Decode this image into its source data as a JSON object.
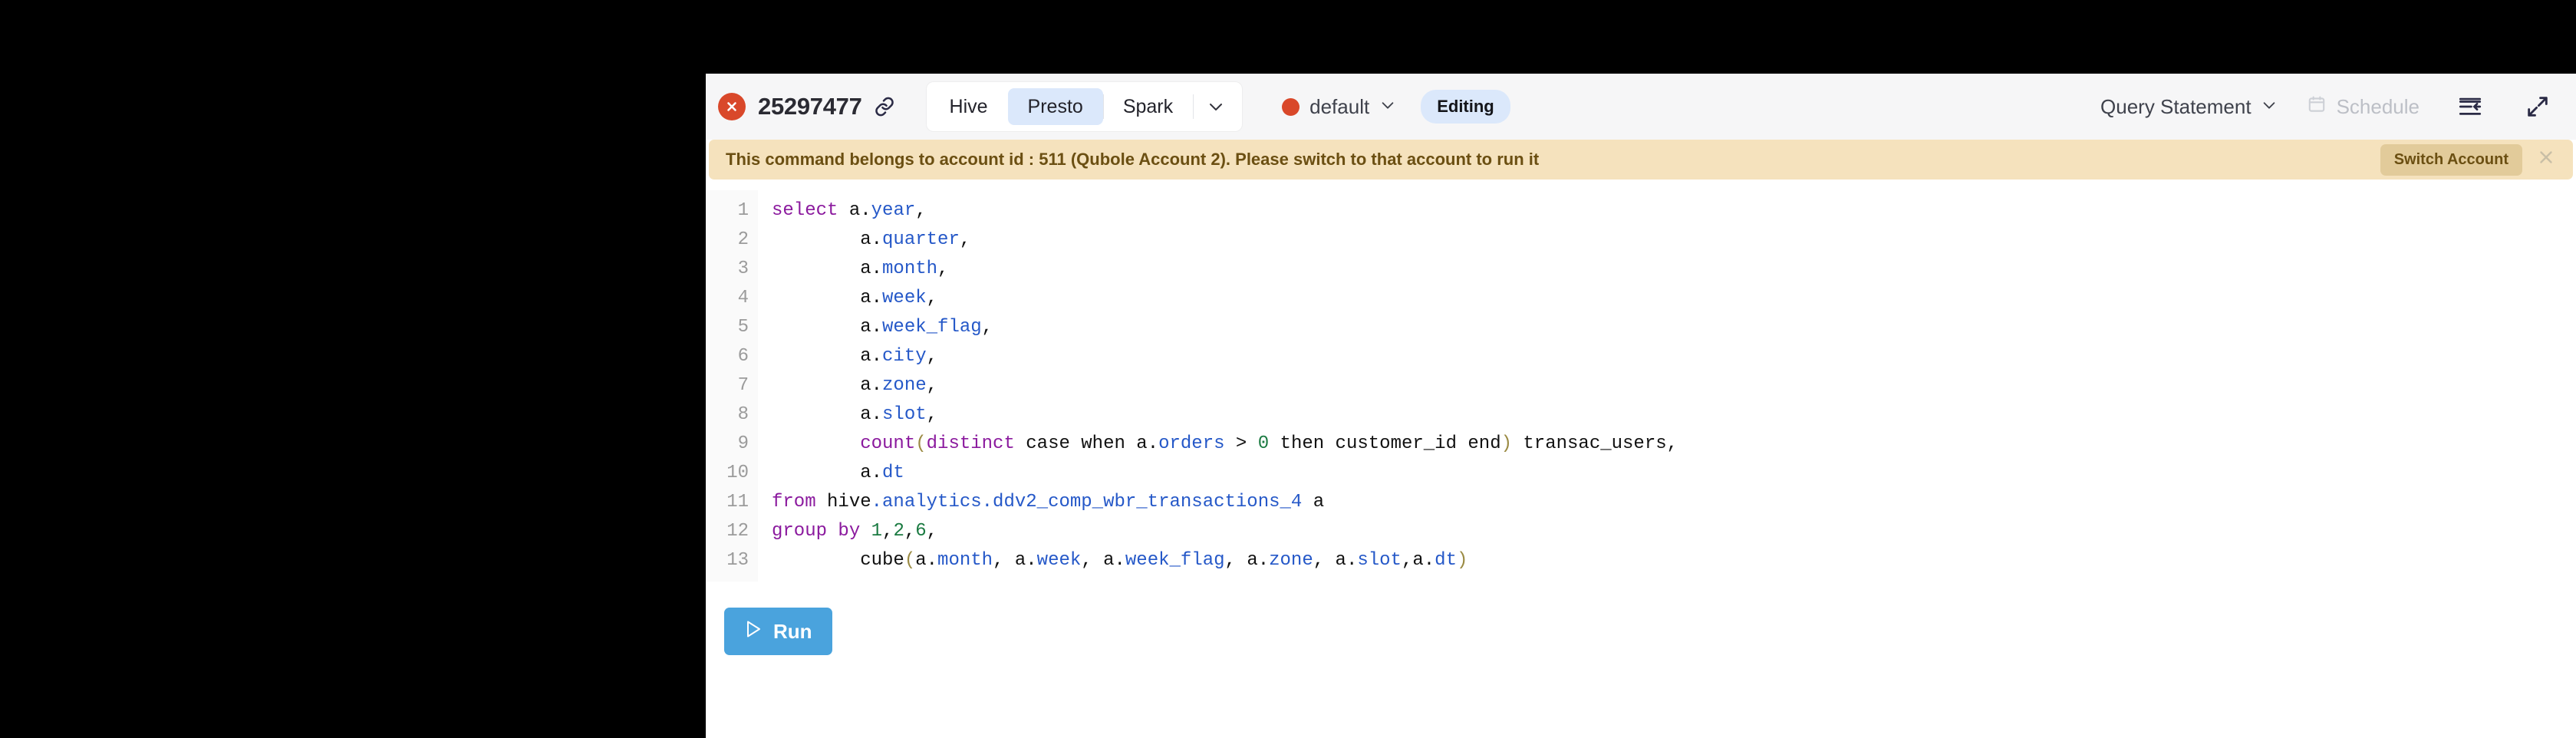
{
  "toolbar": {
    "status_icon": "error-close-icon",
    "query_id": "25297477",
    "link_icon": "link-icon",
    "engines": [
      {
        "label": "Hive",
        "selected": false
      },
      {
        "label": "Presto",
        "selected": true
      },
      {
        "label": "Spark",
        "selected": false
      }
    ],
    "engine_caret_icon": "chevron-down-icon",
    "cluster": {
      "name": "default",
      "status_color": "#d9482a",
      "caret_icon": "chevron-down-icon"
    },
    "editing_badge": "Editing",
    "query_statement": {
      "label": "Query Statement",
      "caret_icon": "chevron-down-icon"
    },
    "schedule": {
      "label": "Schedule",
      "icon": "calendar-icon",
      "disabled": true
    },
    "collapse_icon": "indent-collapse-icon",
    "expand_icon": "expand-diagonal-icon"
  },
  "banner": {
    "message": "This command belongs to account id : 511 (Qubole Account 2). Please switch to that account to run it",
    "action_label": "Switch Account",
    "close_icon": "close-icon",
    "background": "#f5e2bd",
    "text_color": "#6b4f12"
  },
  "editor": {
    "line_numbers": [
      "1",
      "2",
      "3",
      "4",
      "5",
      "6",
      "7",
      "8",
      "9",
      "10",
      "11",
      "12",
      "13"
    ],
    "lines": [
      [
        {
          "t": "select",
          "c": "kw"
        },
        {
          "t": " a",
          "c": "pl"
        },
        {
          "t": ".",
          "c": "pl"
        },
        {
          "t": "year",
          "c": "col"
        },
        {
          "t": ",",
          "c": "pl"
        }
      ],
      [
        {
          "t": "        a.",
          "c": "pl"
        },
        {
          "t": "quarter",
          "c": "col"
        },
        {
          "t": ",",
          "c": "pl"
        }
      ],
      [
        {
          "t": "        a.",
          "c": "pl"
        },
        {
          "t": "month",
          "c": "col"
        },
        {
          "t": ",",
          "c": "pl"
        }
      ],
      [
        {
          "t": "        a.",
          "c": "pl"
        },
        {
          "t": "week",
          "c": "col"
        },
        {
          "t": ",",
          "c": "pl"
        }
      ],
      [
        {
          "t": "        a.",
          "c": "pl"
        },
        {
          "t": "week_flag",
          "c": "col"
        },
        {
          "t": ",",
          "c": "pl"
        }
      ],
      [
        {
          "t": "        a.",
          "c": "pl"
        },
        {
          "t": "city",
          "c": "col"
        },
        {
          "t": ",",
          "c": "pl"
        }
      ],
      [
        {
          "t": "        a.",
          "c": "pl"
        },
        {
          "t": "zone",
          "c": "col"
        },
        {
          "t": ",",
          "c": "pl"
        }
      ],
      [
        {
          "t": "        a.",
          "c": "pl"
        },
        {
          "t": "slot",
          "c": "col"
        },
        {
          "t": ",",
          "c": "pl"
        }
      ],
      [
        {
          "t": "        ",
          "c": "pl"
        },
        {
          "t": "count",
          "c": "kw"
        },
        {
          "t": "(",
          "c": "par"
        },
        {
          "t": "distinct",
          "c": "kw"
        },
        {
          "t": " case when a.",
          "c": "pl"
        },
        {
          "t": "orders",
          "c": "col"
        },
        {
          "t": " > ",
          "c": "pl"
        },
        {
          "t": "0",
          "c": "num"
        },
        {
          "t": " then customer_id end",
          "c": "pl"
        },
        {
          "t": ")",
          "c": "par"
        },
        {
          "t": " transac_users,",
          "c": "pl"
        }
      ],
      [
        {
          "t": "        a.",
          "c": "pl"
        },
        {
          "t": "dt",
          "c": "col"
        }
      ],
      [
        {
          "t": "from",
          "c": "kw"
        },
        {
          "t": " hive",
          "c": "pl"
        },
        {
          "t": ".analytics.ddv2_comp_wbr_transactions_4",
          "c": "col"
        },
        {
          "t": " a",
          "c": "pl"
        }
      ],
      [
        {
          "t": "group by",
          "c": "kw"
        },
        {
          "t": " ",
          "c": "pl"
        },
        {
          "t": "1",
          "c": "num"
        },
        {
          "t": ",",
          "c": "pl"
        },
        {
          "t": "2",
          "c": "num"
        },
        {
          "t": ",",
          "c": "pl"
        },
        {
          "t": "6",
          "c": "num"
        },
        {
          "t": ",",
          "c": "pl"
        }
      ],
      [
        {
          "t": "        cube",
          "c": "pl"
        },
        {
          "t": "(",
          "c": "par"
        },
        {
          "t": "a.",
          "c": "pl"
        },
        {
          "t": "month",
          "c": "col"
        },
        {
          "t": ", a.",
          "c": "pl"
        },
        {
          "t": "week",
          "c": "col"
        },
        {
          "t": ", a.",
          "c": "pl"
        },
        {
          "t": "week_flag",
          "c": "col"
        },
        {
          "t": ", a.",
          "c": "pl"
        },
        {
          "t": "zone",
          "c": "col"
        },
        {
          "t": ", a.",
          "c": "pl"
        },
        {
          "t": "slot",
          "c": "col"
        },
        {
          "t": ",a.",
          "c": "pl"
        },
        {
          "t": "dt",
          "c": "col"
        },
        {
          "t": ")",
          "c": "par"
        }
      ]
    ]
  },
  "actions": {
    "run_label": "Run",
    "run_icon": "play-triangle-icon",
    "run_color": "#4aa3dd"
  }
}
